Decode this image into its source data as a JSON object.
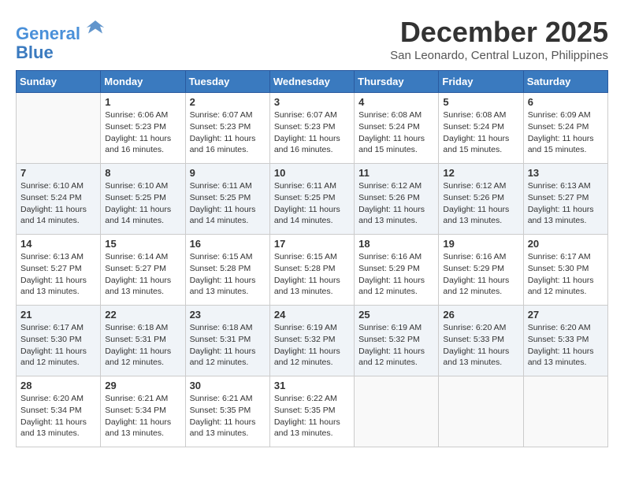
{
  "header": {
    "logo_line1": "General",
    "logo_line2": "Blue",
    "month": "December 2025",
    "location": "San Leonardo, Central Luzon, Philippines"
  },
  "days_of_week": [
    "Sunday",
    "Monday",
    "Tuesday",
    "Wednesday",
    "Thursday",
    "Friday",
    "Saturday"
  ],
  "weeks": [
    [
      {
        "day": "",
        "info": ""
      },
      {
        "day": "1",
        "info": "Sunrise: 6:06 AM\nSunset: 5:23 PM\nDaylight: 11 hours and 16 minutes."
      },
      {
        "day": "2",
        "info": "Sunrise: 6:07 AM\nSunset: 5:23 PM\nDaylight: 11 hours and 16 minutes."
      },
      {
        "day": "3",
        "info": "Sunrise: 6:07 AM\nSunset: 5:23 PM\nDaylight: 11 hours and 16 minutes."
      },
      {
        "day": "4",
        "info": "Sunrise: 6:08 AM\nSunset: 5:24 PM\nDaylight: 11 hours and 15 minutes."
      },
      {
        "day": "5",
        "info": "Sunrise: 6:08 AM\nSunset: 5:24 PM\nDaylight: 11 hours and 15 minutes."
      },
      {
        "day": "6",
        "info": "Sunrise: 6:09 AM\nSunset: 5:24 PM\nDaylight: 11 hours and 15 minutes."
      }
    ],
    [
      {
        "day": "7",
        "info": "Sunrise: 6:10 AM\nSunset: 5:24 PM\nDaylight: 11 hours and 14 minutes."
      },
      {
        "day": "8",
        "info": "Sunrise: 6:10 AM\nSunset: 5:25 PM\nDaylight: 11 hours and 14 minutes."
      },
      {
        "day": "9",
        "info": "Sunrise: 6:11 AM\nSunset: 5:25 PM\nDaylight: 11 hours and 14 minutes."
      },
      {
        "day": "10",
        "info": "Sunrise: 6:11 AM\nSunset: 5:25 PM\nDaylight: 11 hours and 14 minutes."
      },
      {
        "day": "11",
        "info": "Sunrise: 6:12 AM\nSunset: 5:26 PM\nDaylight: 11 hours and 13 minutes."
      },
      {
        "day": "12",
        "info": "Sunrise: 6:12 AM\nSunset: 5:26 PM\nDaylight: 11 hours and 13 minutes."
      },
      {
        "day": "13",
        "info": "Sunrise: 6:13 AM\nSunset: 5:27 PM\nDaylight: 11 hours and 13 minutes."
      }
    ],
    [
      {
        "day": "14",
        "info": "Sunrise: 6:13 AM\nSunset: 5:27 PM\nDaylight: 11 hours and 13 minutes."
      },
      {
        "day": "15",
        "info": "Sunrise: 6:14 AM\nSunset: 5:27 PM\nDaylight: 11 hours and 13 minutes."
      },
      {
        "day": "16",
        "info": "Sunrise: 6:15 AM\nSunset: 5:28 PM\nDaylight: 11 hours and 13 minutes."
      },
      {
        "day": "17",
        "info": "Sunrise: 6:15 AM\nSunset: 5:28 PM\nDaylight: 11 hours and 13 minutes."
      },
      {
        "day": "18",
        "info": "Sunrise: 6:16 AM\nSunset: 5:29 PM\nDaylight: 11 hours and 12 minutes."
      },
      {
        "day": "19",
        "info": "Sunrise: 6:16 AM\nSunset: 5:29 PM\nDaylight: 11 hours and 12 minutes."
      },
      {
        "day": "20",
        "info": "Sunrise: 6:17 AM\nSunset: 5:30 PM\nDaylight: 11 hours and 12 minutes."
      }
    ],
    [
      {
        "day": "21",
        "info": "Sunrise: 6:17 AM\nSunset: 5:30 PM\nDaylight: 11 hours and 12 minutes."
      },
      {
        "day": "22",
        "info": "Sunrise: 6:18 AM\nSunset: 5:31 PM\nDaylight: 11 hours and 12 minutes."
      },
      {
        "day": "23",
        "info": "Sunrise: 6:18 AM\nSunset: 5:31 PM\nDaylight: 11 hours and 12 minutes."
      },
      {
        "day": "24",
        "info": "Sunrise: 6:19 AM\nSunset: 5:32 PM\nDaylight: 11 hours and 12 minutes."
      },
      {
        "day": "25",
        "info": "Sunrise: 6:19 AM\nSunset: 5:32 PM\nDaylight: 11 hours and 12 minutes."
      },
      {
        "day": "26",
        "info": "Sunrise: 6:20 AM\nSunset: 5:33 PM\nDaylight: 11 hours and 13 minutes."
      },
      {
        "day": "27",
        "info": "Sunrise: 6:20 AM\nSunset: 5:33 PM\nDaylight: 11 hours and 13 minutes."
      }
    ],
    [
      {
        "day": "28",
        "info": "Sunrise: 6:20 AM\nSunset: 5:34 PM\nDaylight: 11 hours and 13 minutes."
      },
      {
        "day": "29",
        "info": "Sunrise: 6:21 AM\nSunset: 5:34 PM\nDaylight: 11 hours and 13 minutes."
      },
      {
        "day": "30",
        "info": "Sunrise: 6:21 AM\nSunset: 5:35 PM\nDaylight: 11 hours and 13 minutes."
      },
      {
        "day": "31",
        "info": "Sunrise: 6:22 AM\nSunset: 5:35 PM\nDaylight: 11 hours and 13 minutes."
      },
      {
        "day": "",
        "info": ""
      },
      {
        "day": "",
        "info": ""
      },
      {
        "day": "",
        "info": ""
      }
    ]
  ]
}
